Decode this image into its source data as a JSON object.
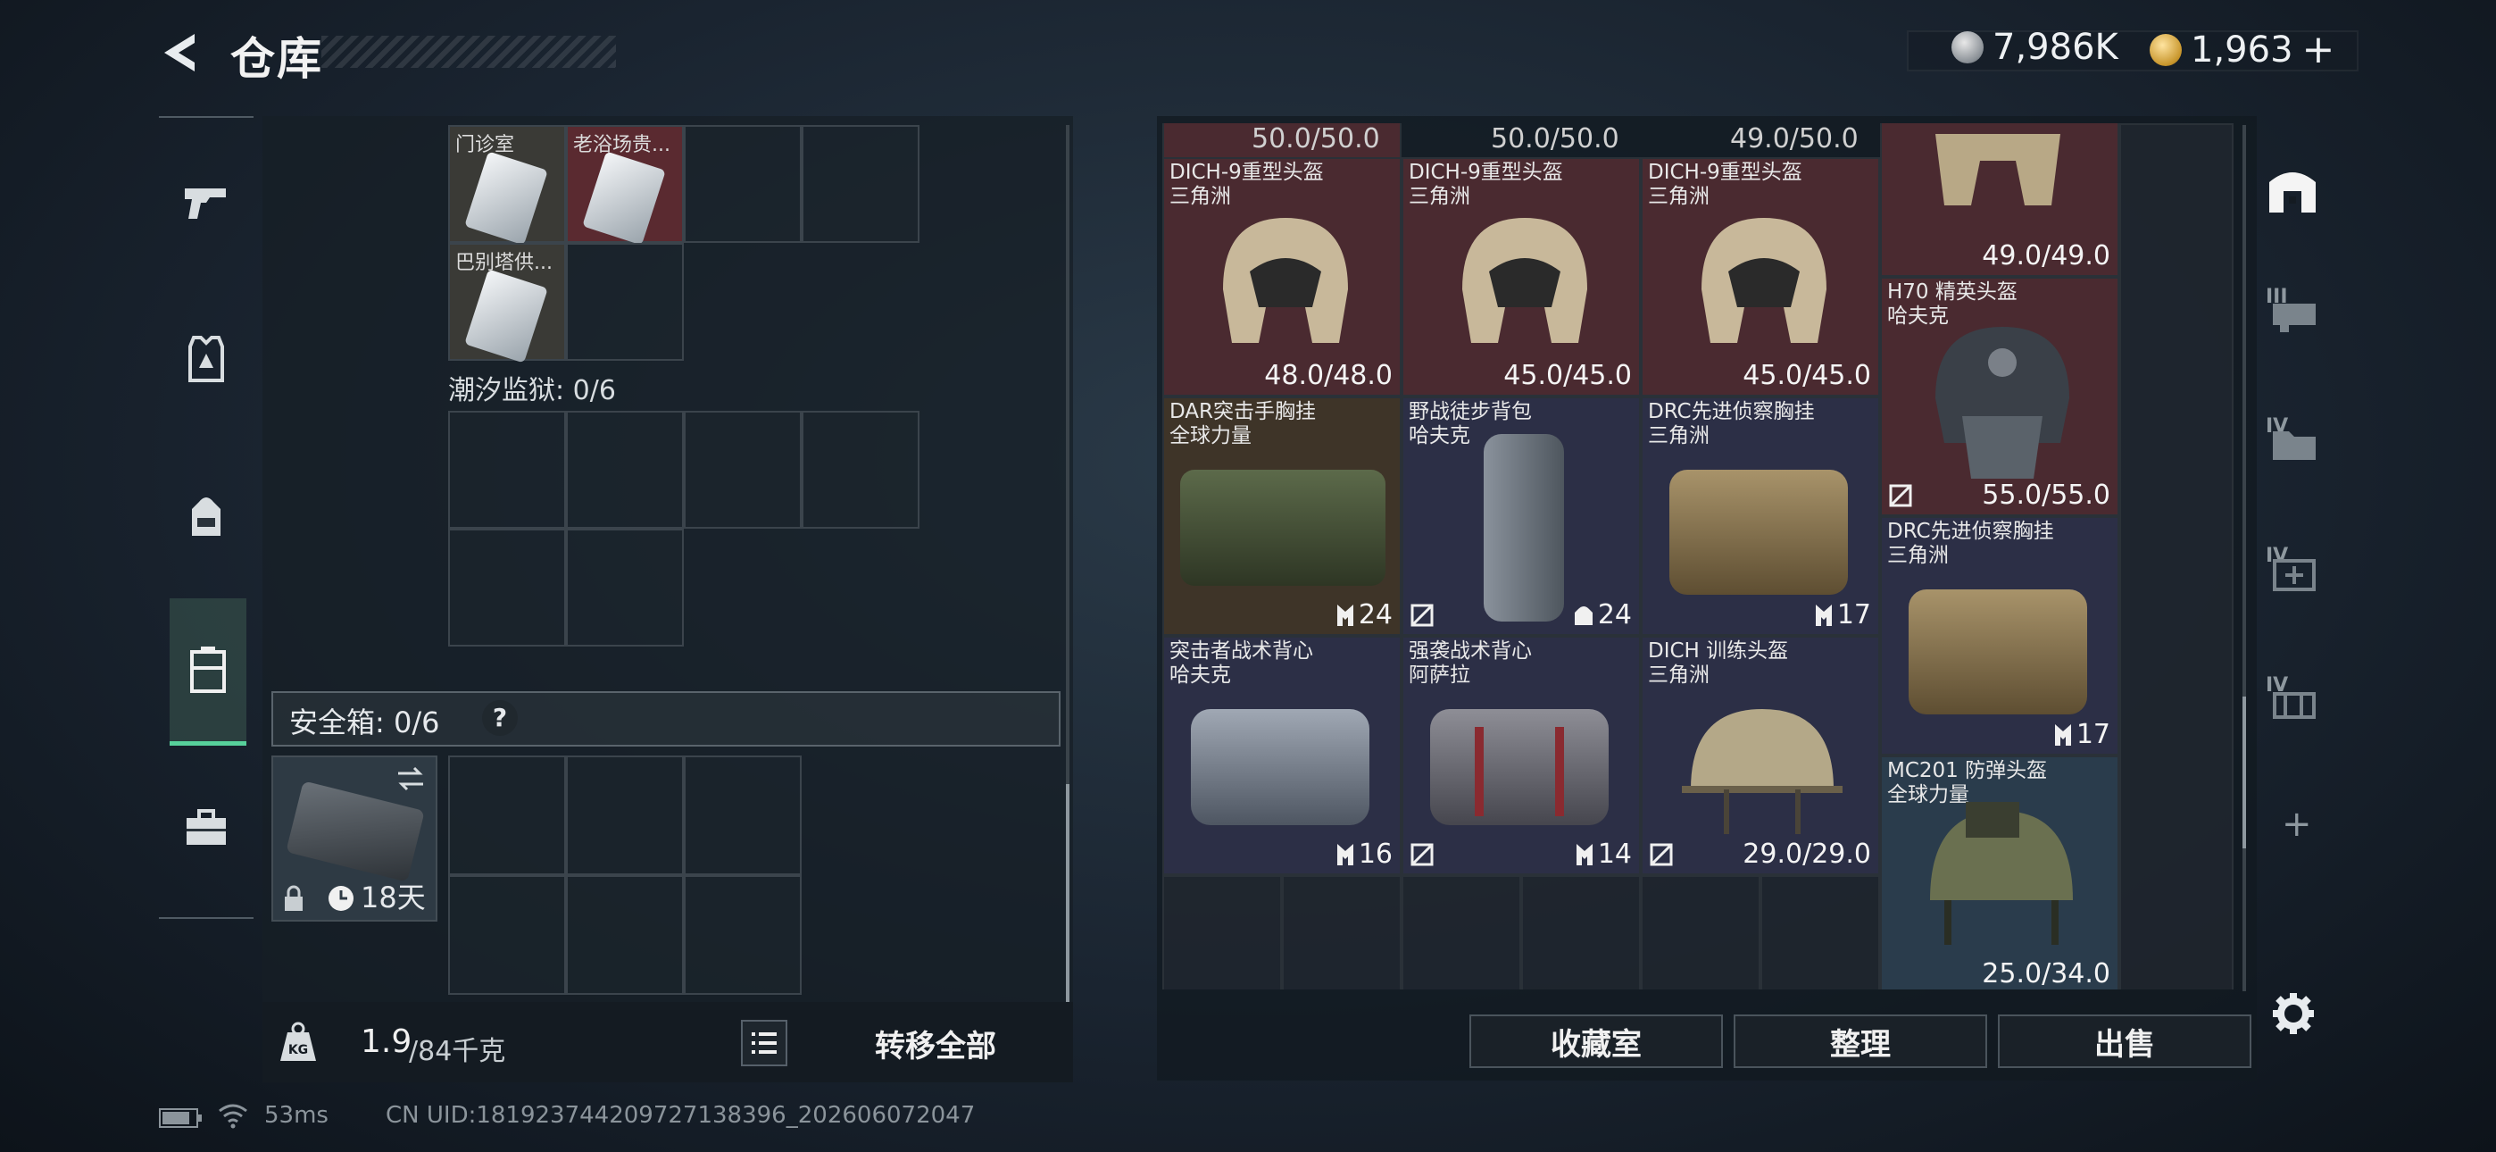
{
  "header": {
    "title": "仓库",
    "currency_1": "7,986K",
    "currency_2": "1,963",
    "add_symbol": "+"
  },
  "left_nav": {
    "items": [
      "gun-icon",
      "armor-icon",
      "backpack-icon",
      "container-icon",
      "toolbox-icon"
    ]
  },
  "left_panel": {
    "keys": [
      {
        "label": "门诊室"
      },
      {
        "label": "老浴场贵..."
      },
      {
        "label": "巴别塔供..."
      }
    ],
    "section_label": "潮汐监狱: 0/6",
    "safe_box": {
      "label": "安全箱: 0/6",
      "help": "?",
      "days": "18天"
    },
    "weight": {
      "current": "1.9",
      "max": "/84千克"
    },
    "transfer_all": "转移全部"
  },
  "top_values": [
    "50.0/50.0",
    "50.0/50.0",
    "49.0/50.0"
  ],
  "items": [
    {
      "name1": "DICH-9重型头盔",
      "name2": "三角洲",
      "value": "48.0/48.0"
    },
    {
      "name1": "DICH-9重型头盔",
      "name2": "三角洲",
      "value": "45.0/45.0"
    },
    {
      "name1": "DICH-9重型头盔",
      "name2": "三角洲",
      "value": "45.0/45.0"
    },
    {
      "name1": "",
      "name2": "",
      "value": "49.0/49.0"
    },
    {
      "name1": "H70 精英头盔",
      "name2": "哈夫克",
      "value": "55.0/55.0"
    },
    {
      "name1": "DAR突击手胸挂",
      "name2": "全球力量",
      "count": "24"
    },
    {
      "name1": "野战徒步背包",
      "name2": "哈夫克",
      "count": "24"
    },
    {
      "name1": "DRC先进侦察胸挂",
      "name2": "三角洲",
      "count": "17"
    },
    {
      "name1": "DRC先进侦察胸挂",
      "name2": "三角洲",
      "count": "17"
    },
    {
      "name1": "突击者战术背心",
      "name2": "哈夫克",
      "count": "16"
    },
    {
      "name1": "强袭战术背心",
      "name2": "阿萨拉",
      "count": "14"
    },
    {
      "name1": "DICH 训练头盔",
      "name2": "三角洲",
      "value": "29.0/29.0"
    },
    {
      "name1": "MC201 防弹头盔",
      "name2": "全球力量",
      "value": "25.0/34.0"
    }
  ],
  "right_nav": {
    "tiers": [
      "III",
      "IV",
      "IV",
      "IV"
    ],
    "plus": "+"
  },
  "buttons": {
    "collection": "收藏室",
    "sort": "整理",
    "sell": "出售"
  },
  "status": {
    "ping": "53ms",
    "uid": "CN UID:1819237442097271383​96_202606072047"
  },
  "colors": {
    "accent": "#57d19b",
    "red_rarity": "#4a2a30",
    "purple_rarity": "#2c2f46",
    "gold_rarity": "#3e3428",
    "blue_rarity": "#2a3c4c"
  }
}
